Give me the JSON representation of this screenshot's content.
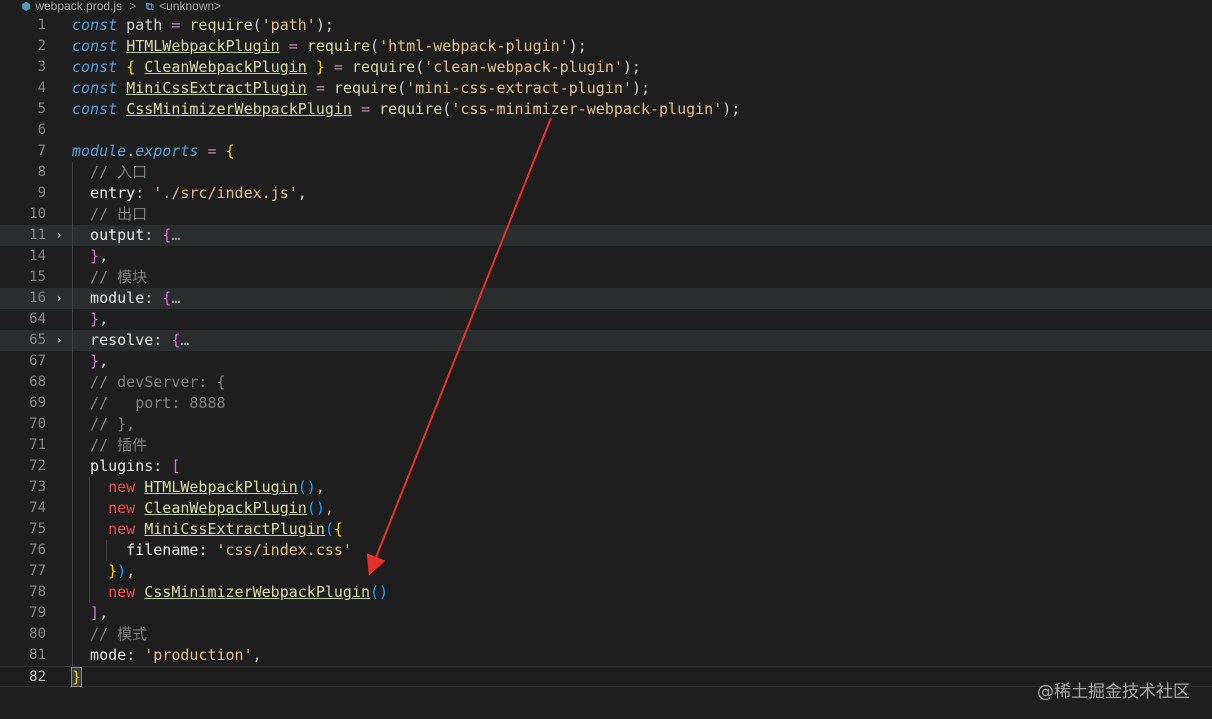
{
  "breadcrumb": {
    "file_icon": "webpack-file-icon",
    "file": "webpack.prod.js",
    "separator": ">",
    "symbol_icon": "symbol-variable-icon",
    "symbol": "<unknown>"
  },
  "lines": [
    {
      "n": "1",
      "t": [
        [
          "kw",
          "const"
        ],
        [
          "var",
          " path "
        ],
        [
          "op",
          "="
        ],
        [
          "var",
          " "
        ],
        [
          "fn",
          "require"
        ],
        [
          "var",
          "("
        ],
        [
          "str",
          "'path'"
        ],
        [
          "var",
          ");"
        ]
      ]
    },
    {
      "n": "2",
      "t": [
        [
          "kw",
          "const"
        ],
        [
          "var",
          " "
        ],
        [
          "cls",
          "HTMLWebpackPlugin"
        ],
        [
          "var",
          " "
        ],
        [
          "op",
          "="
        ],
        [
          "var",
          " "
        ],
        [
          "fn",
          "require"
        ],
        [
          "var",
          "("
        ],
        [
          "str",
          "'html-webpack-plugin'"
        ],
        [
          "var",
          ");"
        ]
      ]
    },
    {
      "n": "3",
      "t": [
        [
          "kw",
          "const"
        ],
        [
          "var",
          " "
        ],
        [
          "brace3",
          "{"
        ],
        [
          "var",
          " "
        ],
        [
          "cls",
          "CleanWebpackPlugin"
        ],
        [
          "var",
          " "
        ],
        [
          "brace3",
          "}"
        ],
        [
          "var",
          " "
        ],
        [
          "op",
          "="
        ],
        [
          "var",
          " "
        ],
        [
          "fn",
          "require"
        ],
        [
          "var",
          "("
        ],
        [
          "str",
          "'clean-webpack-plugin'"
        ],
        [
          "var",
          ");"
        ]
      ]
    },
    {
      "n": "4",
      "t": [
        [
          "kw",
          "const"
        ],
        [
          "var",
          " "
        ],
        [
          "cls",
          "MiniCssExtractPlugin"
        ],
        [
          "var",
          " "
        ],
        [
          "op",
          "="
        ],
        [
          "var",
          " "
        ],
        [
          "fn",
          "require"
        ],
        [
          "var",
          "("
        ],
        [
          "str",
          "'mini-css-extract-plugin'"
        ],
        [
          "var",
          ");"
        ]
      ]
    },
    {
      "n": "5",
      "t": [
        [
          "kw",
          "const"
        ],
        [
          "var",
          " "
        ],
        [
          "cls",
          "CssMinimizerWebpackPlugin"
        ],
        [
          "var",
          " "
        ],
        [
          "op",
          "="
        ],
        [
          "var",
          " "
        ],
        [
          "fn",
          "require"
        ],
        [
          "var",
          "("
        ],
        [
          "str",
          "'css-minimizer-webpack-plugin'"
        ],
        [
          "var",
          ");"
        ]
      ]
    },
    {
      "n": "6",
      "t": []
    },
    {
      "n": "7",
      "t": [
        [
          "kw",
          "module"
        ],
        [
          "var",
          "."
        ],
        [
          "kw",
          "exports"
        ],
        [
          "var",
          " "
        ],
        [
          "op",
          "="
        ],
        [
          "var",
          " "
        ],
        [
          "brace3",
          "{"
        ]
      ]
    },
    {
      "n": "8",
      "g": 1,
      "t": [
        [
          "cm",
          "  // 入口"
        ]
      ]
    },
    {
      "n": "9",
      "g": 1,
      "t": [
        [
          "prop",
          "  entry"
        ],
        [
          "var",
          ": "
        ],
        [
          "str",
          "'./src/index.js'"
        ],
        [
          "var",
          ","
        ]
      ]
    },
    {
      "n": "10",
      "g": 1,
      "t": [
        [
          "cm",
          "  // 出口"
        ]
      ]
    },
    {
      "n": "11",
      "g": 1,
      "fold": true,
      "folded": true,
      "t": [
        [
          "prop",
          "  output"
        ],
        [
          "var",
          ": "
        ],
        [
          "brace",
          "{"
        ],
        [
          "dots",
          "…"
        ]
      ]
    },
    {
      "n": "14",
      "g": 1,
      "t": [
        [
          "brace",
          "  }"
        ],
        [
          "var",
          ","
        ]
      ]
    },
    {
      "n": "15",
      "g": 1,
      "t": [
        [
          "cm",
          "  // 模块"
        ]
      ]
    },
    {
      "n": "16",
      "g": 1,
      "fold": true,
      "folded": true,
      "t": [
        [
          "prop",
          "  module"
        ],
        [
          "var",
          ": "
        ],
        [
          "brace",
          "{"
        ],
        [
          "dots",
          "…"
        ]
      ]
    },
    {
      "n": "64",
      "g": 1,
      "t": [
        [
          "brace",
          "  }"
        ],
        [
          "var",
          ","
        ]
      ]
    },
    {
      "n": "65",
      "g": 1,
      "fold": true,
      "folded": true,
      "t": [
        [
          "prop",
          "  resolve"
        ],
        [
          "var",
          ": "
        ],
        [
          "brace",
          "{"
        ],
        [
          "dots",
          "…"
        ]
      ]
    },
    {
      "n": "67",
      "g": 1,
      "t": [
        [
          "brace",
          "  }"
        ],
        [
          "var",
          ","
        ]
      ]
    },
    {
      "n": "68",
      "g": 1,
      "t": [
        [
          "cm",
          "  // devServer: {"
        ]
      ]
    },
    {
      "n": "69",
      "g": 1,
      "t": [
        [
          "cm",
          "  //   port: 8888"
        ]
      ]
    },
    {
      "n": "70",
      "g": 1,
      "t": [
        [
          "cm",
          "  // },"
        ]
      ]
    },
    {
      "n": "71",
      "g": 1,
      "t": [
        [
          "cm",
          "  // 插件"
        ]
      ]
    },
    {
      "n": "72",
      "g": 1,
      "t": [
        [
          "prop",
          "  plugins"
        ],
        [
          "var",
          ": "
        ],
        [
          "brace",
          "["
        ]
      ]
    },
    {
      "n": "73",
      "g": 2,
      "t": [
        [
          "var",
          "    "
        ],
        [
          "new",
          "new"
        ],
        [
          "var",
          " "
        ],
        [
          "cls",
          "HTMLWebpackPlugin"
        ],
        [
          "brace2",
          "()"
        ],
        [
          "var",
          ","
        ]
      ]
    },
    {
      "n": "74",
      "g": 2,
      "t": [
        [
          "var",
          "    "
        ],
        [
          "new",
          "new"
        ],
        [
          "var",
          " "
        ],
        [
          "cls",
          "CleanWebpackPlugin"
        ],
        [
          "brace2",
          "()"
        ],
        [
          "var",
          ","
        ]
      ]
    },
    {
      "n": "75",
      "g": 2,
      "t": [
        [
          "var",
          "    "
        ],
        [
          "new",
          "new"
        ],
        [
          "var",
          " "
        ],
        [
          "cls",
          "MiniCssExtractPlugin"
        ],
        [
          "brace2",
          "("
        ],
        [
          "brace3",
          "{"
        ]
      ]
    },
    {
      "n": "76",
      "g": 3,
      "t": [
        [
          "prop",
          "      filename"
        ],
        [
          "var",
          ": "
        ],
        [
          "str",
          "'css/index.css'"
        ]
      ]
    },
    {
      "n": "77",
      "g": 2,
      "t": [
        [
          "var",
          "    "
        ],
        [
          "brace3",
          "}"
        ],
        [
          "brace2",
          ")"
        ],
        [
          "var",
          ","
        ]
      ]
    },
    {
      "n": "78",
      "g": 2,
      "t": [
        [
          "var",
          "    "
        ],
        [
          "new",
          "new"
        ],
        [
          "var",
          " "
        ],
        [
          "cls",
          "CssMinimizerWebpackPlugin"
        ],
        [
          "brace2",
          "()"
        ]
      ]
    },
    {
      "n": "79",
      "g": 1,
      "t": [
        [
          "brace",
          "  ]"
        ],
        [
          "var",
          ","
        ]
      ]
    },
    {
      "n": "80",
      "g": 1,
      "t": [
        [
          "cm",
          "  // 模式"
        ]
      ]
    },
    {
      "n": "81",
      "g": 1,
      "t": [
        [
          "prop",
          "  mode"
        ],
        [
          "var",
          ": "
        ],
        [
          "str",
          "'production'"
        ],
        [
          "var",
          ","
        ]
      ]
    },
    {
      "n": "82",
      "current": true,
      "t": [
        [
          "cursor-brace",
          "}"
        ]
      ]
    }
  ],
  "fold_icon": "chevron-right-icon",
  "annotation": {
    "color": "#e5312a",
    "icon": "red-arrow"
  },
  "watermark": "@稀土掘金技术社区"
}
